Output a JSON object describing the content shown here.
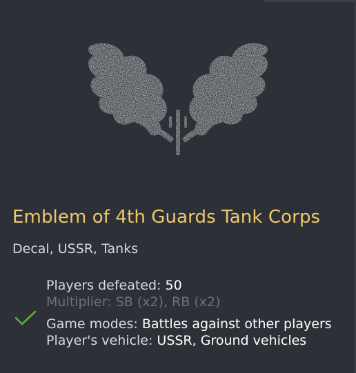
{
  "item": {
    "title": "Emblem of 4th Guards Tank Corps",
    "subtitle": "Decal, USSR, Tanks",
    "emblem_icon": "oak-leaves-emblem-icon"
  },
  "conditions": {
    "players_defeated_label": "Players defeated:",
    "players_defeated_value": "50",
    "multiplier_label": "Multiplier:",
    "multiplier_value": "SB (x2), RB (x2)",
    "game_modes_label": "Game modes:",
    "game_modes_value": "Battles against other players",
    "vehicle_label": "Player's vehicle:",
    "vehicle_value": "USSR, Ground vehicles",
    "status_icon": "checkmark-icon"
  },
  "colors": {
    "background": "#2d3137",
    "title": "#f0c86a",
    "check": "#5fae3c",
    "emblem": "#e4e4e4"
  }
}
